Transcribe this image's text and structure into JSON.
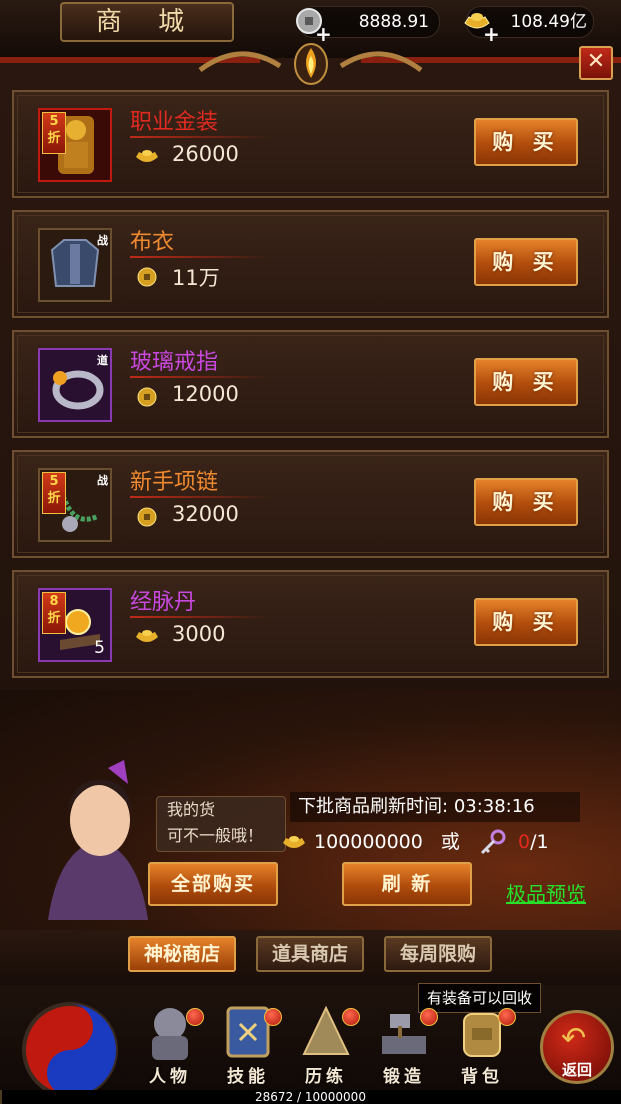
{
  "header": {
    "title": "商 城",
    "silver": "8888.91",
    "gold": "108.49亿"
  },
  "items": [
    {
      "name": "职业金装",
      "name_color": "#e02a20",
      "badge": "5\n折",
      "tag": "",
      "count": "",
      "currency": "ingot",
      "price": "26000",
      "buy_label": "购 买",
      "frame_color": "#c01a10"
    },
    {
      "name": "布衣",
      "name_color": "#f08a30",
      "badge": "",
      "tag": "战",
      "count": "",
      "currency": "coin",
      "price": "11万",
      "buy_label": "购 买",
      "frame_color": "#8a6a3a"
    },
    {
      "name": "玻璃戒指",
      "name_color": "#c848e0",
      "badge": "",
      "tag": "道",
      "count": "",
      "currency": "coin",
      "price": "12000",
      "buy_label": "购 买",
      "frame_color": "#8a3ab0"
    },
    {
      "name": "新手项链",
      "name_color": "#f08a30",
      "badge": "5\n折",
      "tag": "战",
      "count": "",
      "currency": "coin",
      "price": "32000",
      "buy_label": "购 买",
      "frame_color": "#8a6a3a"
    },
    {
      "name": "经脉丹",
      "name_color": "#c848e0",
      "badge": "8\n折",
      "tag": "",
      "count": "5",
      "currency": "ingot",
      "price": "3000",
      "buy_label": "购 买",
      "frame_color": "#8a3ab0"
    }
  ],
  "npc": {
    "speech_line1": "我的货",
    "speech_line2": "可不一般哦！"
  },
  "refresh": {
    "label": "下批商品刷新时间:",
    "time": "03:38:16",
    "cost_ingot": "100000000",
    "or_label": "或",
    "key_count": "0",
    "key_total": "/1"
  },
  "buttons": {
    "buy_all": "全部购买",
    "refresh": "刷 新",
    "preview": "极品预览"
  },
  "tabs": [
    {
      "label": "神秘商店",
      "active": true
    },
    {
      "label": "道具商店",
      "active": false
    },
    {
      "label": "每周限购",
      "active": false
    }
  ],
  "hint": "有装备可以回收",
  "nav": [
    {
      "label": "人物",
      "icon": "character-icon"
    },
    {
      "label": "技能",
      "icon": "skill-book-icon"
    },
    {
      "label": "历练",
      "icon": "training-icon"
    },
    {
      "label": "锻造",
      "icon": "forge-icon"
    },
    {
      "label": "背包",
      "icon": "backpack-icon"
    }
  ],
  "back_label": "返回",
  "exp": {
    "text": "28672 / 10000000",
    "current": 28672,
    "max": 10000000
  },
  "colors": {
    "buy_button": "#d86a1c",
    "preview_link": "#26e02a",
    "key_count": "#e02a20"
  }
}
